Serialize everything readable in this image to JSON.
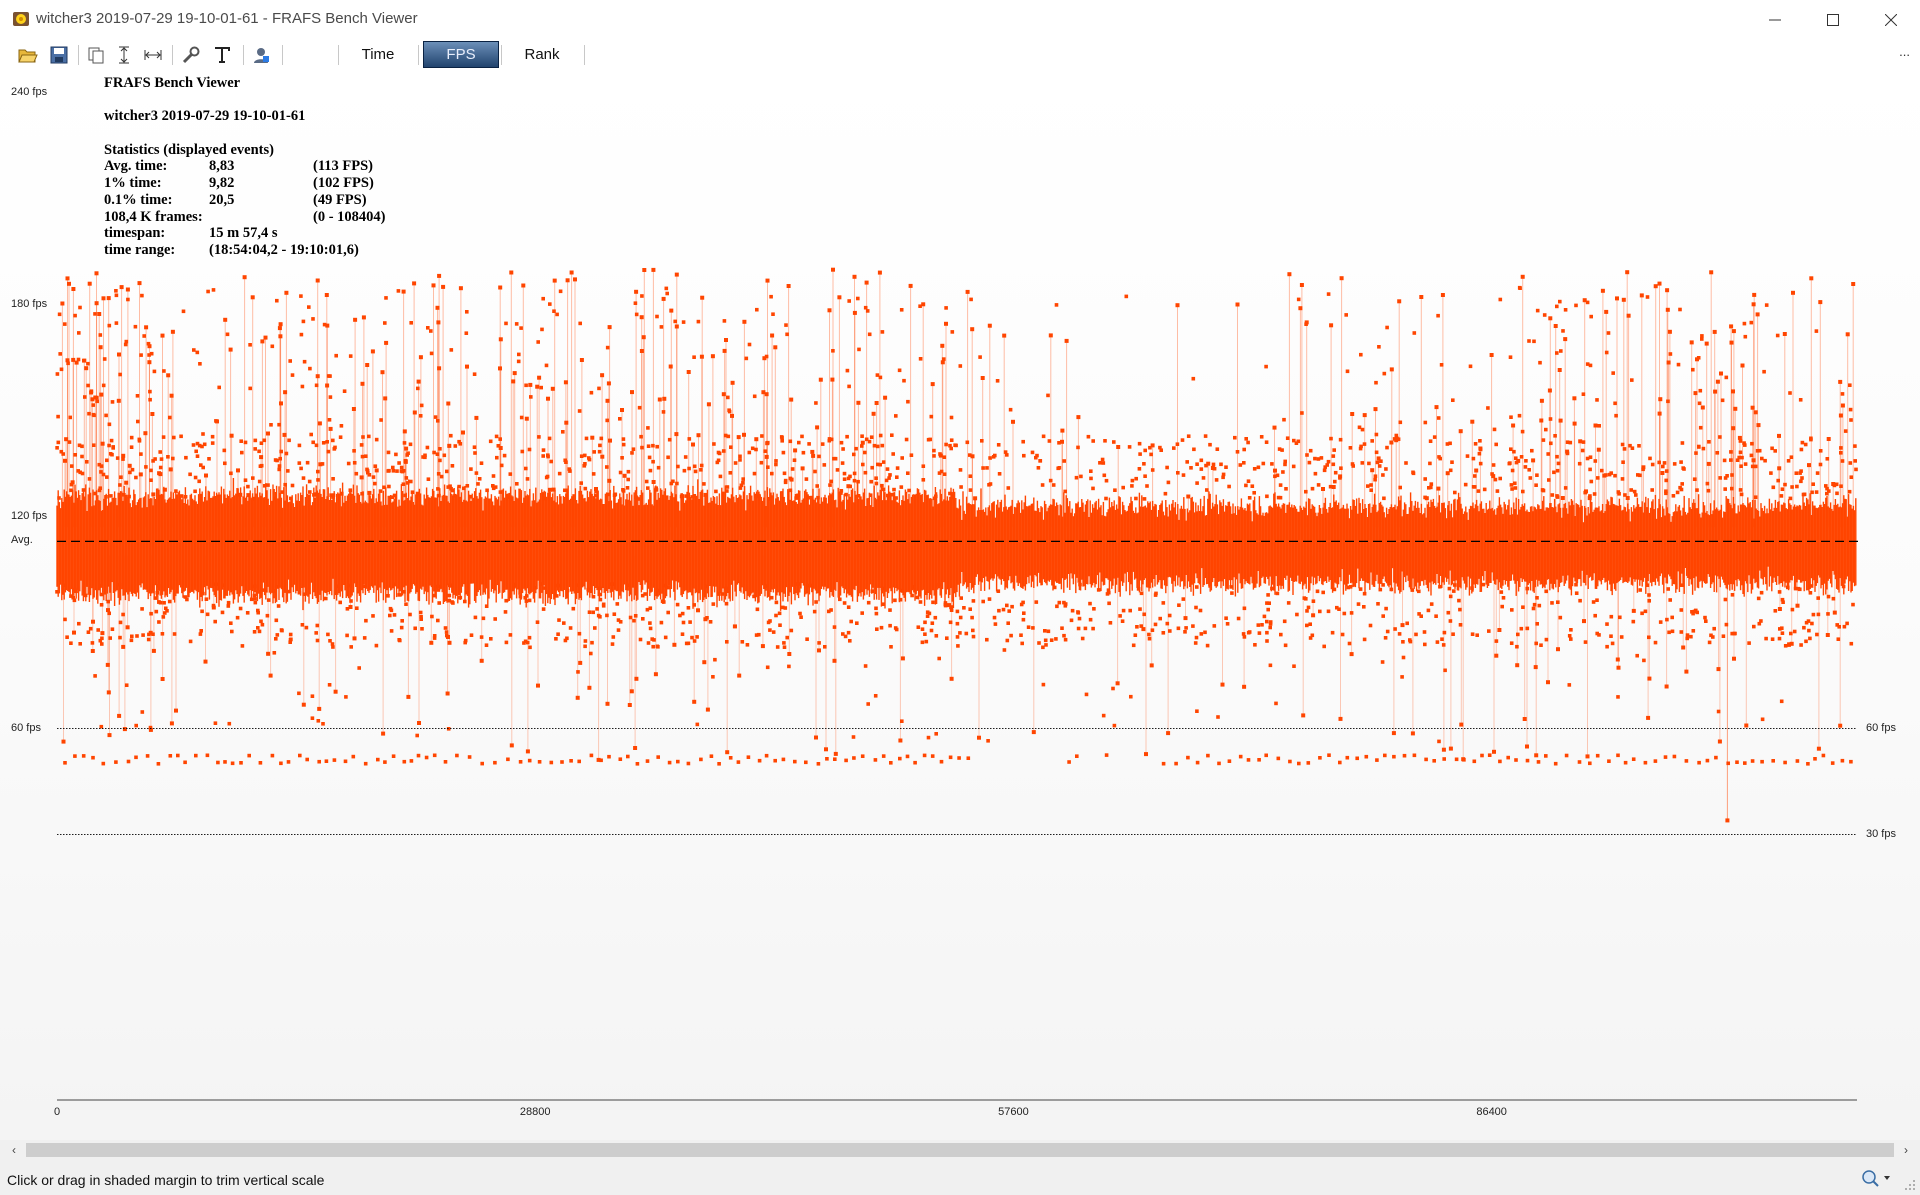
{
  "window": {
    "title": "witcher3 2019-07-29 19-10-01-61 - FRAFS Bench Viewer"
  },
  "toolbar": {
    "icons": [
      "open-folder-icon",
      "save-icon",
      "copy-icon",
      "fit-vertical-icon",
      "fit-horizontal-icon",
      "wrench-icon",
      "text-icon",
      "user-icon"
    ],
    "tabs": [
      {
        "label": "Time",
        "active": false
      },
      {
        "label": "FPS",
        "active": true
      },
      {
        "label": "Rank",
        "active": false
      }
    ],
    "overflow": "..."
  },
  "stats": {
    "app_title": "FRAFS Bench Viewer",
    "run_name": "witcher3 2019-07-29 19-10-01-61",
    "heading": "Statistics (displayed events)",
    "rows": [
      {
        "label": "Avg. time:",
        "value": "8,83",
        "extra": "(113 FPS)"
      },
      {
        "label": "1% time:",
        "value": "9,82",
        "extra": "(102 FPS)"
      },
      {
        "label": "0.1% time:",
        "value": "20,5",
        "extra": "(49 FPS)"
      },
      {
        "label": "108,4 K frames:",
        "value": "",
        "extra": "(0 - 108404)"
      },
      {
        "label": "timespan:",
        "value": "15 m 57,4 s",
        "extra": ""
      },
      {
        "label": "time range:",
        "value": "(18:54:04,2 - 19:10:01,6)",
        "extra": ""
      }
    ]
  },
  "chart_data": {
    "type": "scatter",
    "series_color": "#ff4500",
    "x_range": [
      0,
      108404
    ],
    "x_ticks": [
      {
        "value": 0,
        "label": "0"
      },
      {
        "value": 28800,
        "label": "28800"
      },
      {
        "value": 57600,
        "label": "57600"
      },
      {
        "value": 86400,
        "label": "86400"
      }
    ],
    "y_range": [
      0,
      240
    ],
    "y_ticks_left": [
      {
        "value": 240,
        "label": "240 fps"
      },
      {
        "value": 180,
        "label": "180 fps"
      },
      {
        "value": 120,
        "label": "120 fps"
      },
      {
        "value": 113,
        "label": "Avg."
      },
      {
        "value": 60,
        "label": "60 fps"
      }
    ],
    "reference_lines": [
      {
        "value": 113,
        "label": "Avg.",
        "style": "dashed",
        "right_label": ""
      },
      {
        "value": 60,
        "label": "60 fps",
        "style": "dotted",
        "right_label": "60 fps"
      },
      {
        "value": 30,
        "label": "30 fps",
        "style": "dotted",
        "right_label": "30 fps"
      }
    ],
    "stats": {
      "avg_fps": 113,
      "p1_fps": 102,
      "p01_fps": 49,
      "frames": 108404,
      "typical_max_fps": 190,
      "typical_min_fps": 50,
      "absolute_min_fps": 34
    }
  },
  "scrollbar": {
    "left_arrow": "‹",
    "right_arrow": "›"
  },
  "status": {
    "text": "Click or drag in shaded margin to trim vertical scale"
  }
}
